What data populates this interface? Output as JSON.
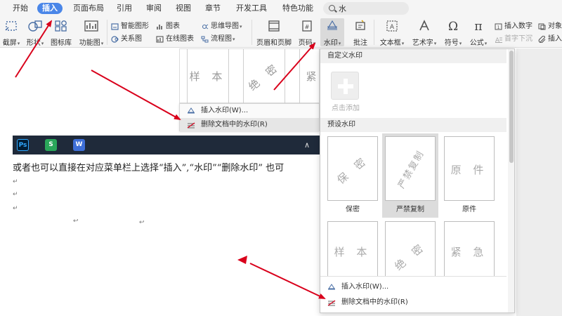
{
  "menu_tabs": [
    "开始",
    "插入",
    "页面布局",
    "引用",
    "审阅",
    "视图",
    "章节",
    "开发工具",
    "特色功能"
  ],
  "active_tab": "插入",
  "search": {
    "value": "水"
  },
  "ribbon": {
    "screenshot": "截屏",
    "shapes": "形状",
    "icon_library": "图标库",
    "function_chart": "功能图",
    "smart_shape": "智能图形",
    "chart": "图表",
    "relation_diagram": "关系图",
    "online_chart": "在线图表",
    "mind_map": "思维导图",
    "flowchart": "流程图",
    "header_footer": "页眉和页脚",
    "page_number": "页码",
    "watermark": "水印",
    "comment": "批注",
    "textbox": "文本框",
    "art_text": "艺术字",
    "symbol": "符号",
    "formula": "公式",
    "insert_number": "插入数字",
    "first_sink": "首字下沉",
    "object": "对象",
    "insert": "插入"
  },
  "embedded_preview": {
    "cards": [
      "样 本",
      "绝 密",
      "紧"
    ],
    "menu_items": [
      "插入水印(W)...",
      "删除文档中的水印(R)"
    ]
  },
  "taskbar": {
    "apps": [
      "Ps",
      "S",
      "W"
    ],
    "chevron": "∧"
  },
  "document": {
    "line1": "或者也可以直接在对应菜单栏上选择“插入”,“水印”“删除水印” 也可",
    "para_mark": "↵",
    "small_mark": "↩"
  },
  "watermark_panel": {
    "custom_section": "自定义水印",
    "add_label": "点击添加",
    "preset_section": "预设水印",
    "presets": [
      {
        "text": "保 密",
        "label": "保密"
      },
      {
        "text": "严禁复制",
        "label": "严禁复制"
      },
      {
        "text": "原 件",
        "label": "原件"
      },
      {
        "text": "样 本",
        "label": ""
      },
      {
        "text": "绝 密",
        "label": ""
      },
      {
        "text": "紧 急",
        "label": ""
      }
    ],
    "selected_preset": "严禁复制",
    "insert_action": "插入水印(W)...",
    "delete_action": "删除文档中的水印(R)"
  },
  "colors": {
    "accent": "#4a86e8",
    "arrow": "#d9001b",
    "taskbar": "#1f2a3a"
  }
}
